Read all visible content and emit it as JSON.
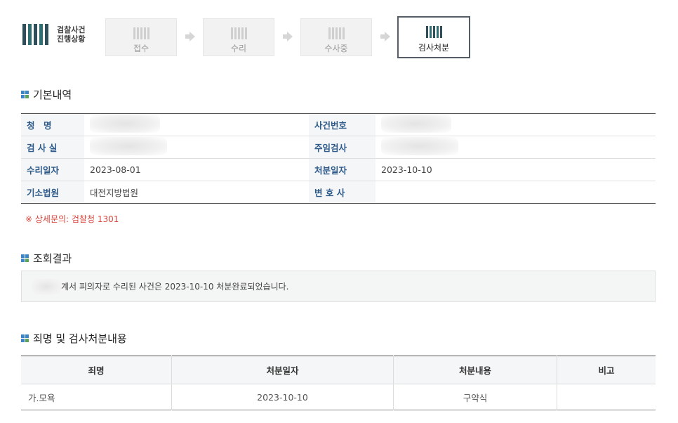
{
  "header": {
    "logo_line1": "검찰사건",
    "logo_line2": "진행상황",
    "steps": [
      {
        "label": "접수",
        "active": false
      },
      {
        "label": "수리",
        "active": false
      },
      {
        "label": "수사중",
        "active": false
      },
      {
        "label": "검사처분",
        "active": true
      }
    ]
  },
  "basic": {
    "title": "기본내역",
    "rows": [
      {
        "label1": "청　명",
        "value1": "",
        "label2": "사건번호",
        "value2": ""
      },
      {
        "label1": "검 사 실",
        "value1": "",
        "label2": "주임검사",
        "value2": ""
      },
      {
        "label1": "수리일자",
        "value1": "2023-08-01",
        "label2": "처분일자",
        "value2": "2023-10-10"
      },
      {
        "label1": "기소법원",
        "value1": "대전지방법원",
        "label2": "변 호 사",
        "value2": ""
      }
    ],
    "note": "※ 상세문의: 검찰청 1301"
  },
  "result": {
    "title": "조회결과",
    "text": "계서 피의자로 수리된 사건은 2023-10-10 처분완료되었습니다."
  },
  "disposition": {
    "title": "죄명 및 검사처분내용",
    "headers": [
      "죄명",
      "처분일자",
      "처분내용",
      "비고"
    ],
    "rows": [
      {
        "charge": "가.모욕",
        "date": "2023-10-10",
        "content": "구약식",
        "remark": ""
      }
    ]
  }
}
